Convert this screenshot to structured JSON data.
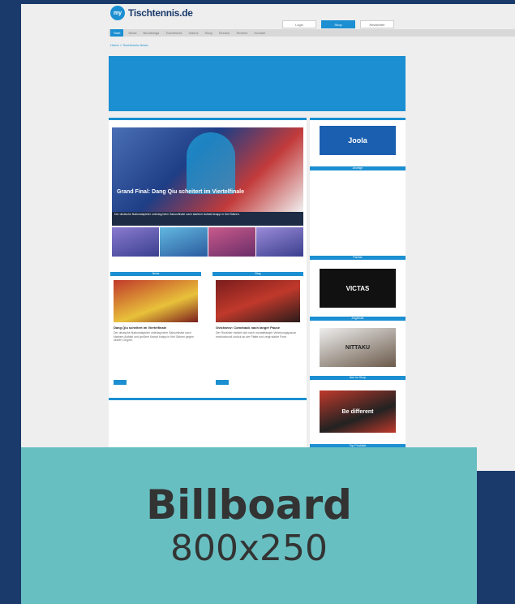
{
  "site": {
    "logo_badge": "my",
    "logo_text": "Tischtennis.de"
  },
  "header_buttons": [
    {
      "label": "Login"
    },
    {
      "label": "Shop"
    },
    {
      "label": "Newsletter"
    }
  ],
  "nav": [
    "Start",
    "News",
    "Bundesliga",
    "Tischtennis",
    "Videos",
    "Shop",
    "Service",
    "Termine",
    "Kontakt"
  ],
  "breadcrumb": "Home » Tischtennis-News",
  "hero": {
    "title": "Grand Final: Dang Qiu scheitert im Viertelfinale",
    "caption": "Der deutsche Nationalspieler unterlag beim Saisonfinale nach starkem Auftakt knapp in fünf Sätzen."
  },
  "columns": [
    {
      "header": "News",
      "title": "Dang Qiu scheitert im Viertelfinale",
      "text": "Der deutsche Nationalspieler unterlag beim Saisonfinale nach starkem Auftakt und großem Kampf knapp in fünf Sätzen gegen seinen Gegner.",
      "button": "mehr"
    },
    {
      "header": "Blog",
      "title": "Ovtcharov: Comeback nach langer Pause",
      "text": "Der Routinier meldet sich nach monatelanger Verletzungspause eindrucksvoll zurück an der Platte und zeigt starke Form.",
      "button": "mehr"
    }
  ],
  "sidebar": {
    "ad1": "Joola",
    "widgets": [
      "Anzeige",
      "Partner",
      "Angebote",
      "Neu im Shop",
      "Top-Produkte"
    ],
    "ad_victas": "VICTAS",
    "ad_nittaku": "NITTAKU",
    "ad_different": "Be different"
  },
  "billboard_label": {
    "title": "Billboard",
    "size": "800x250"
  },
  "colors": {
    "accent": "#1b8fd1",
    "background": "#1a3a6b",
    "label_bg": "#68bfc1"
  }
}
